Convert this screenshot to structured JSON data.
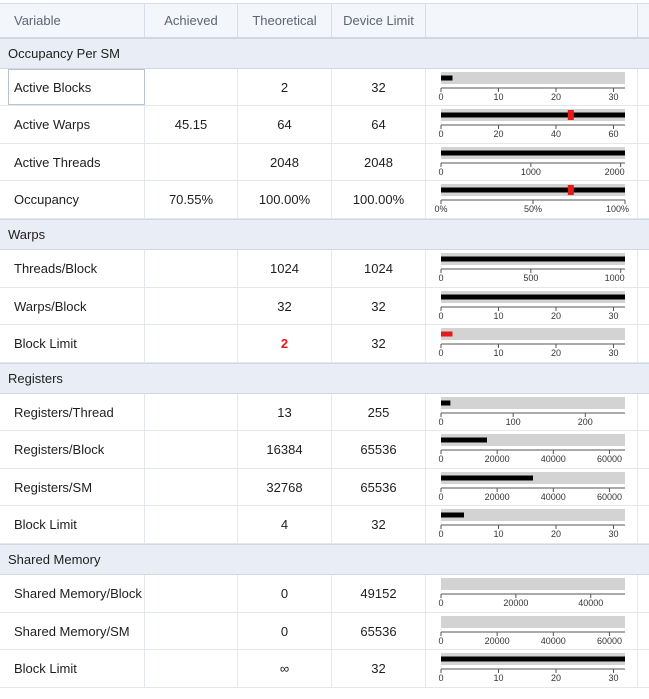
{
  "columns": [
    "Variable",
    "Achieved",
    "Theoretical",
    "Device Limit"
  ],
  "sections": [
    {
      "title": "Occupancy Per SM",
      "rows": [
        {
          "variable": "Active Blocks",
          "achieved": "",
          "theoretical": "2",
          "device_limit": "32",
          "selected": true,
          "bar": {
            "max": 32,
            "ticks": [
              "0",
              "10",
              "20",
              "30"
            ],
            "tick_values": [
              0,
              10,
              20,
              30
            ],
            "theoretical_fraction": 0.0625,
            "achieved_fraction": null,
            "limit_fraction": 1.0
          }
        },
        {
          "variable": "Active Warps",
          "achieved": "45.15",
          "theoretical": "64",
          "device_limit": "64",
          "bar": {
            "max": 64,
            "ticks": [
              "0",
              "20",
              "40",
              "60"
            ],
            "tick_values": [
              0,
              20,
              40,
              60
            ],
            "theoretical_fraction": 1.0,
            "achieved_fraction": 0.7055,
            "limit_fraction": 1.0
          }
        },
        {
          "variable": "Active Threads",
          "achieved": "",
          "theoretical": "2048",
          "device_limit": "2048",
          "bar": {
            "max": 2048,
            "ticks": [
              "0",
              "1000",
              "2000"
            ],
            "tick_values": [
              0,
              1000,
              2000
            ],
            "theoretical_fraction": 1.0,
            "achieved_fraction": null,
            "limit_fraction": 1.0
          }
        },
        {
          "variable": "Occupancy",
          "achieved": "70.55%",
          "theoretical": "100.00%",
          "device_limit": "100.00%",
          "bar": {
            "max": 100,
            "ticks": [
              "0%",
              "50%",
              "100%"
            ],
            "tick_values": [
              0,
              50,
              100
            ],
            "theoretical_fraction": 1.0,
            "achieved_fraction": 0.7055,
            "limit_fraction": 1.0
          }
        }
      ]
    },
    {
      "title": "Warps",
      "rows": [
        {
          "variable": "Threads/Block",
          "achieved": "",
          "theoretical": "1024",
          "device_limit": "1024",
          "bar": {
            "max": 1024,
            "ticks": [
              "0",
              "500",
              "1000"
            ],
            "tick_values": [
              0,
              500,
              1000
            ],
            "theoretical_fraction": 1.0,
            "achieved_fraction": null,
            "limit_fraction": 1.0
          }
        },
        {
          "variable": "Warps/Block",
          "achieved": "",
          "theoretical": "32",
          "device_limit": "32",
          "bar": {
            "max": 32,
            "ticks": [
              "0",
              "10",
              "20",
              "30"
            ],
            "tick_values": [
              0,
              10,
              20,
              30
            ],
            "theoretical_fraction": 1.0,
            "achieved_fraction": null,
            "limit_fraction": 1.0
          }
        },
        {
          "variable": "Block Limit",
          "achieved": "",
          "theoretical": "2",
          "device_limit": "32",
          "theoretical_red": true,
          "bar": {
            "max": 32,
            "ticks": [
              "0",
              "10",
              "20",
              "30"
            ],
            "tick_values": [
              0,
              10,
              20,
              30
            ],
            "theoretical_fraction": 0.0625,
            "achieved_fraction": null,
            "limit_fraction": 1.0,
            "red": true
          }
        }
      ]
    },
    {
      "title": "Registers",
      "rows": [
        {
          "variable": "Registers/Thread",
          "achieved": "",
          "theoretical": "13",
          "device_limit": "255",
          "bar": {
            "max": 255,
            "ticks": [
              "0",
              "100",
              "200"
            ],
            "tick_values": [
              0,
              100,
              200
            ],
            "theoretical_fraction": 0.051,
            "achieved_fraction": null,
            "limit_fraction": 1.0
          }
        },
        {
          "variable": "Registers/Block",
          "achieved": "",
          "theoretical": "16384",
          "device_limit": "65536",
          "bar": {
            "max": 65536,
            "ticks": [
              "0",
              "20000",
              "40000",
              "60000"
            ],
            "tick_values": [
              0,
              20000,
              40000,
              60000
            ],
            "theoretical_fraction": 0.25,
            "achieved_fraction": null,
            "limit_fraction": 1.0
          }
        },
        {
          "variable": "Registers/SM",
          "achieved": "",
          "theoretical": "32768",
          "device_limit": "65536",
          "bar": {
            "max": 65536,
            "ticks": [
              "0",
              "20000",
              "40000",
              "60000"
            ],
            "tick_values": [
              0,
              20000,
              40000,
              60000
            ],
            "theoretical_fraction": 0.5,
            "achieved_fraction": null,
            "limit_fraction": 1.0
          }
        },
        {
          "variable": "Block Limit",
          "achieved": "",
          "theoretical": "4",
          "device_limit": "32",
          "bar": {
            "max": 32,
            "ticks": [
              "0",
              "10",
              "20",
              "30"
            ],
            "tick_values": [
              0,
              10,
              20,
              30
            ],
            "theoretical_fraction": 0.125,
            "achieved_fraction": null,
            "limit_fraction": 1.0
          }
        }
      ]
    },
    {
      "title": "Shared Memory",
      "rows": [
        {
          "variable": "Shared Memory/Block",
          "achieved": "",
          "theoretical": "0",
          "device_limit": "49152",
          "bar": {
            "max": 49152,
            "ticks": [
              "0",
              "20000",
              "40000"
            ],
            "tick_values": [
              0,
              20000,
              40000
            ],
            "theoretical_fraction": 0,
            "achieved_fraction": null,
            "limit_fraction": 1.0
          }
        },
        {
          "variable": "Shared Memory/SM",
          "achieved": "",
          "theoretical": "0",
          "device_limit": "65536",
          "bar": {
            "max": 65536,
            "ticks": [
              "0",
              "20000",
              "40000",
              "60000"
            ],
            "tick_values": [
              0,
              20000,
              40000,
              60000
            ],
            "theoretical_fraction": 0,
            "achieved_fraction": null,
            "limit_fraction": 1.0
          }
        },
        {
          "variable": "Block Limit",
          "achieved": "",
          "theoretical": "∞",
          "device_limit": "32",
          "bar": {
            "max": 32,
            "ticks": [
              "0",
              "10",
              "20",
              "30"
            ],
            "tick_values": [
              0,
              10,
              20,
              30
            ],
            "theoretical_fraction": 1.0,
            "achieved_fraction": null,
            "limit_fraction": 1.0
          }
        }
      ]
    }
  ],
  "colors": {
    "track": "#d3d3d3",
    "value": "#000000",
    "achieved_marker": "#e31b1b",
    "limit_red": "#e31b1b",
    "section_bg": "#e9eef6",
    "header_bg": "#f3f6fa"
  }
}
